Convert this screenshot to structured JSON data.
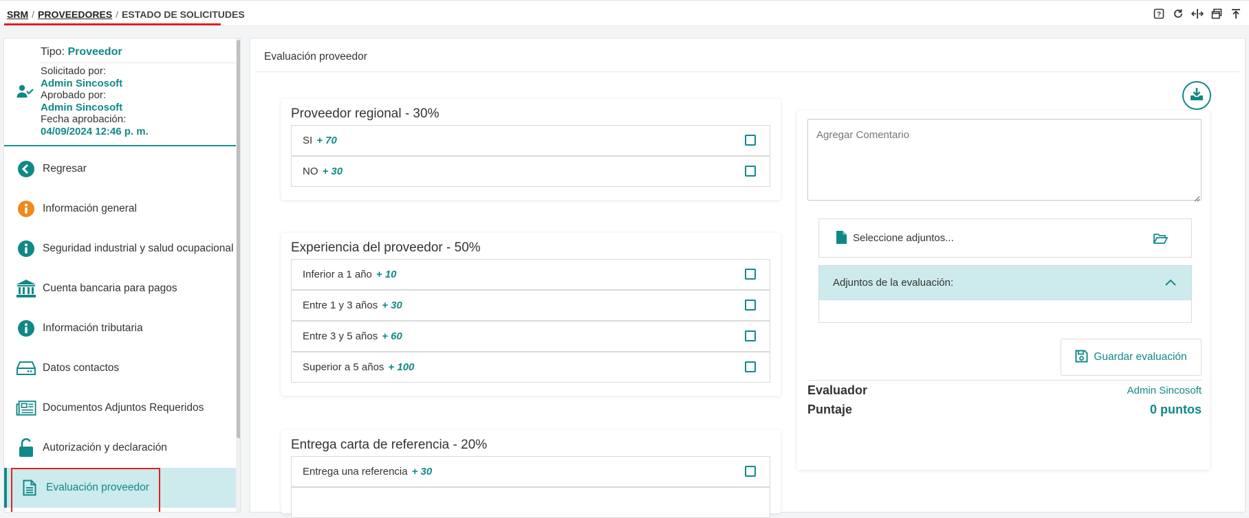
{
  "breadcrumb": {
    "srm": "SRM",
    "sep1": "/",
    "proveedores": "PROVEEDORES",
    "sep2": "/",
    "current": "ESTADO DE SOLICITUDES"
  },
  "toolbar_icons": [
    "help-icon",
    "refresh-icon",
    "split-icon",
    "window-icon",
    "pin-top-icon"
  ],
  "request": {
    "tipo_label": "Tipo:",
    "tipo_value": "Proveedor",
    "solicitado_label": "Solicitado por:",
    "solicitado_value": "Admin Sincosoft",
    "aprobado_label": "Aprobado por:",
    "aprobado_value": "Admin Sincosoft",
    "fecha_label": "Fecha aprobación:",
    "fecha_value": "04/09/2024 12:46 p. m."
  },
  "nav": [
    {
      "label": "Regresar",
      "icon": "back-arrow-icon"
    },
    {
      "label": "Información general",
      "icon": "info-icon"
    },
    {
      "label": "Seguridad industrial y salud ocupacional",
      "icon": "info-icon"
    },
    {
      "label": "Cuenta bancaria para pagos",
      "icon": "bank-icon"
    },
    {
      "label": "Información tributaria",
      "icon": "info-icon"
    },
    {
      "label": "Datos contactos",
      "icon": "drive-icon"
    },
    {
      "label": "Documentos Adjuntos Requeridos",
      "icon": "newspaper-icon"
    },
    {
      "label": "Autorización y declaración",
      "icon": "unlock-icon"
    },
    {
      "label": "Evaluación proveedor",
      "icon": "document-icon"
    }
  ],
  "main": {
    "title": "Evaluación proveedor"
  },
  "criteria": [
    {
      "title": "Proveedor regional",
      "pct": "- 30%",
      "options": [
        {
          "label": "SI",
          "points": "+ 70"
        },
        {
          "label": "NO",
          "points": "+ 30"
        }
      ]
    },
    {
      "title": "Experiencia del proveedor",
      "pct": "- 50%",
      "options": [
        {
          "label": "Inferior a 1 año",
          "points": "+ 10"
        },
        {
          "label": "Entre 1 y 3 años",
          "points": "+ 30"
        },
        {
          "label": "Entre 3 y 5 años",
          "points": "+ 60"
        },
        {
          "label": "Superior a 5 años",
          "points": "+ 100"
        }
      ]
    },
    {
      "title": "Entrega carta de referencia",
      "pct": "- 20%",
      "options": [
        {
          "label": "Entrega una referencia",
          "points": "+ 30"
        }
      ]
    }
  ],
  "right": {
    "comment_placeholder": "Agregar Comentario",
    "attach_label": "Seleccione adjuntos...",
    "attachments_title": "Adjuntos de la evaluación:",
    "save_label": "Guardar evaluación",
    "evaluador_label": "Evaluador",
    "evaluador_value": "Admin Sincosoft",
    "puntaje_label": "Puntaje",
    "puntaje_value": "0 puntos"
  },
  "colors": {
    "accent": "#118888",
    "highlight": "#e02020",
    "active_bg": "#cdeaec",
    "orange": "#f08a1c"
  }
}
